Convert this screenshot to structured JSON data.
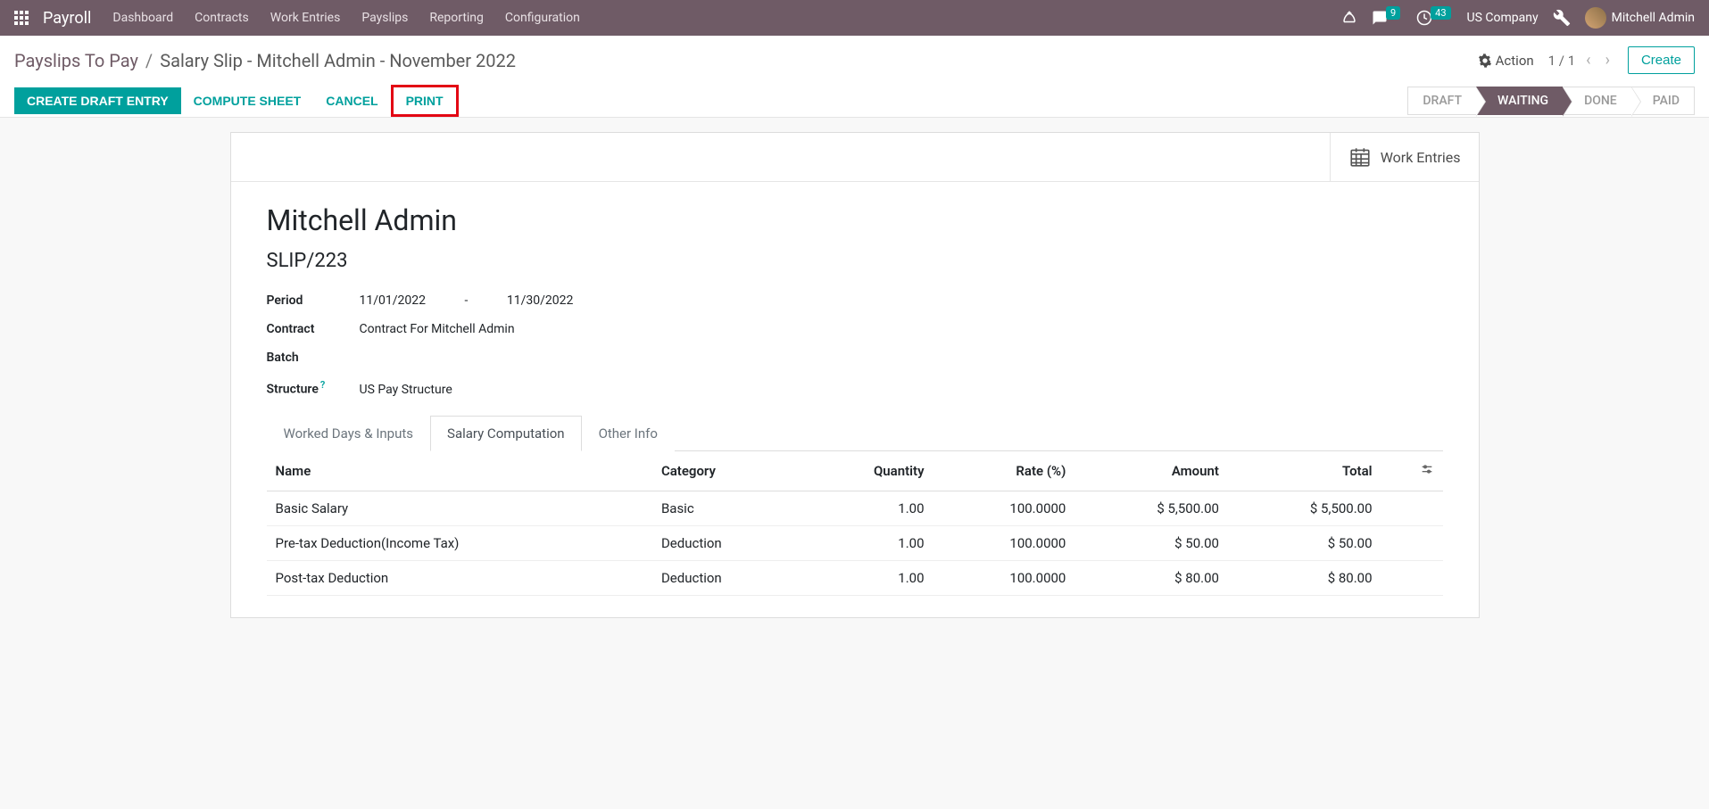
{
  "topnav": {
    "brand": "Payroll",
    "menu": [
      "Dashboard",
      "Contracts",
      "Work Entries",
      "Payslips",
      "Reporting",
      "Configuration"
    ],
    "messages_count": "9",
    "activities_count": "43",
    "company": "US Company",
    "user": "Mitchell Admin"
  },
  "breadcrumb": {
    "parent": "Payslips To Pay",
    "sep": "/",
    "current": "Salary Slip - Mitchell Admin - November 2022"
  },
  "controls": {
    "action": "Action",
    "pager": "1 / 1",
    "create": "Create"
  },
  "buttons": {
    "create_draft": "CREATE DRAFT ENTRY",
    "compute": "COMPUTE SHEET",
    "cancel": "CANCEL",
    "print": "PRINT"
  },
  "status": {
    "draft": "DRAFT",
    "waiting": "WAITING",
    "done": "DONE",
    "paid": "PAID"
  },
  "stat_button": {
    "work_entries": "Work Entries"
  },
  "record": {
    "employee": "Mitchell Admin",
    "reference": "SLIP/223",
    "labels": {
      "period": "Period",
      "contract": "Contract",
      "batch": "Batch",
      "structure": "Structure"
    },
    "period_from": "11/01/2022",
    "period_sep": "-",
    "period_to": "11/30/2022",
    "contract": "Contract For Mitchell Admin",
    "batch": "",
    "structure": "US Pay Structure",
    "help_mark": "?"
  },
  "tabs": {
    "worked": "Worked Days & Inputs",
    "salary": "Salary Computation",
    "other": "Other Info"
  },
  "table": {
    "headers": {
      "name": "Name",
      "category": "Category",
      "quantity": "Quantity",
      "rate": "Rate (%)",
      "amount": "Amount",
      "total": "Total"
    },
    "rows": [
      {
        "name": "Basic Salary",
        "category": "Basic",
        "quantity": "1.00",
        "rate": "100.0000",
        "amount": "$ 5,500.00",
        "total": "$ 5,500.00"
      },
      {
        "name": "Pre-tax Deduction(Income Tax)",
        "category": "Deduction",
        "quantity": "1.00",
        "rate": "100.0000",
        "amount": "$ 50.00",
        "total": "$ 50.00"
      },
      {
        "name": "Post-tax Deduction",
        "category": "Deduction",
        "quantity": "1.00",
        "rate": "100.0000",
        "amount": "$ 80.00",
        "total": "$ 80.00"
      }
    ]
  }
}
